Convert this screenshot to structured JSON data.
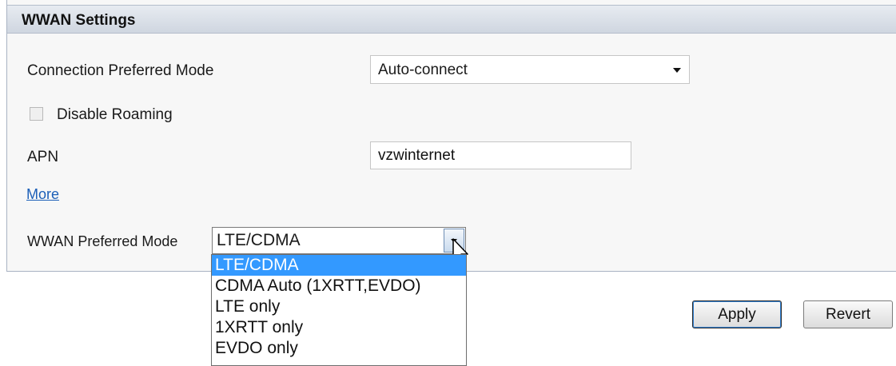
{
  "panel": {
    "title": "WWAN Settings"
  },
  "connection_mode": {
    "label": "Connection Preferred Mode",
    "value": "Auto-connect"
  },
  "roaming": {
    "label": "Disable Roaming",
    "checked": false
  },
  "apn": {
    "label": "APN",
    "value": "vzwinternet"
  },
  "more_link": "More",
  "wwan_mode": {
    "label": "WWAN Preferred Mode",
    "value": "LTE/CDMA",
    "options": [
      "LTE/CDMA",
      "CDMA Auto (1XRTT,EVDO)",
      "LTE only",
      "1XRTT only",
      "EVDO only"
    ],
    "selected_index": 0
  },
  "buttons": {
    "apply": "Apply",
    "revert": "Revert"
  },
  "colors": {
    "header_bg": "#d9dfe7",
    "selection": "#3399ff",
    "link": "#1c5fb8"
  }
}
